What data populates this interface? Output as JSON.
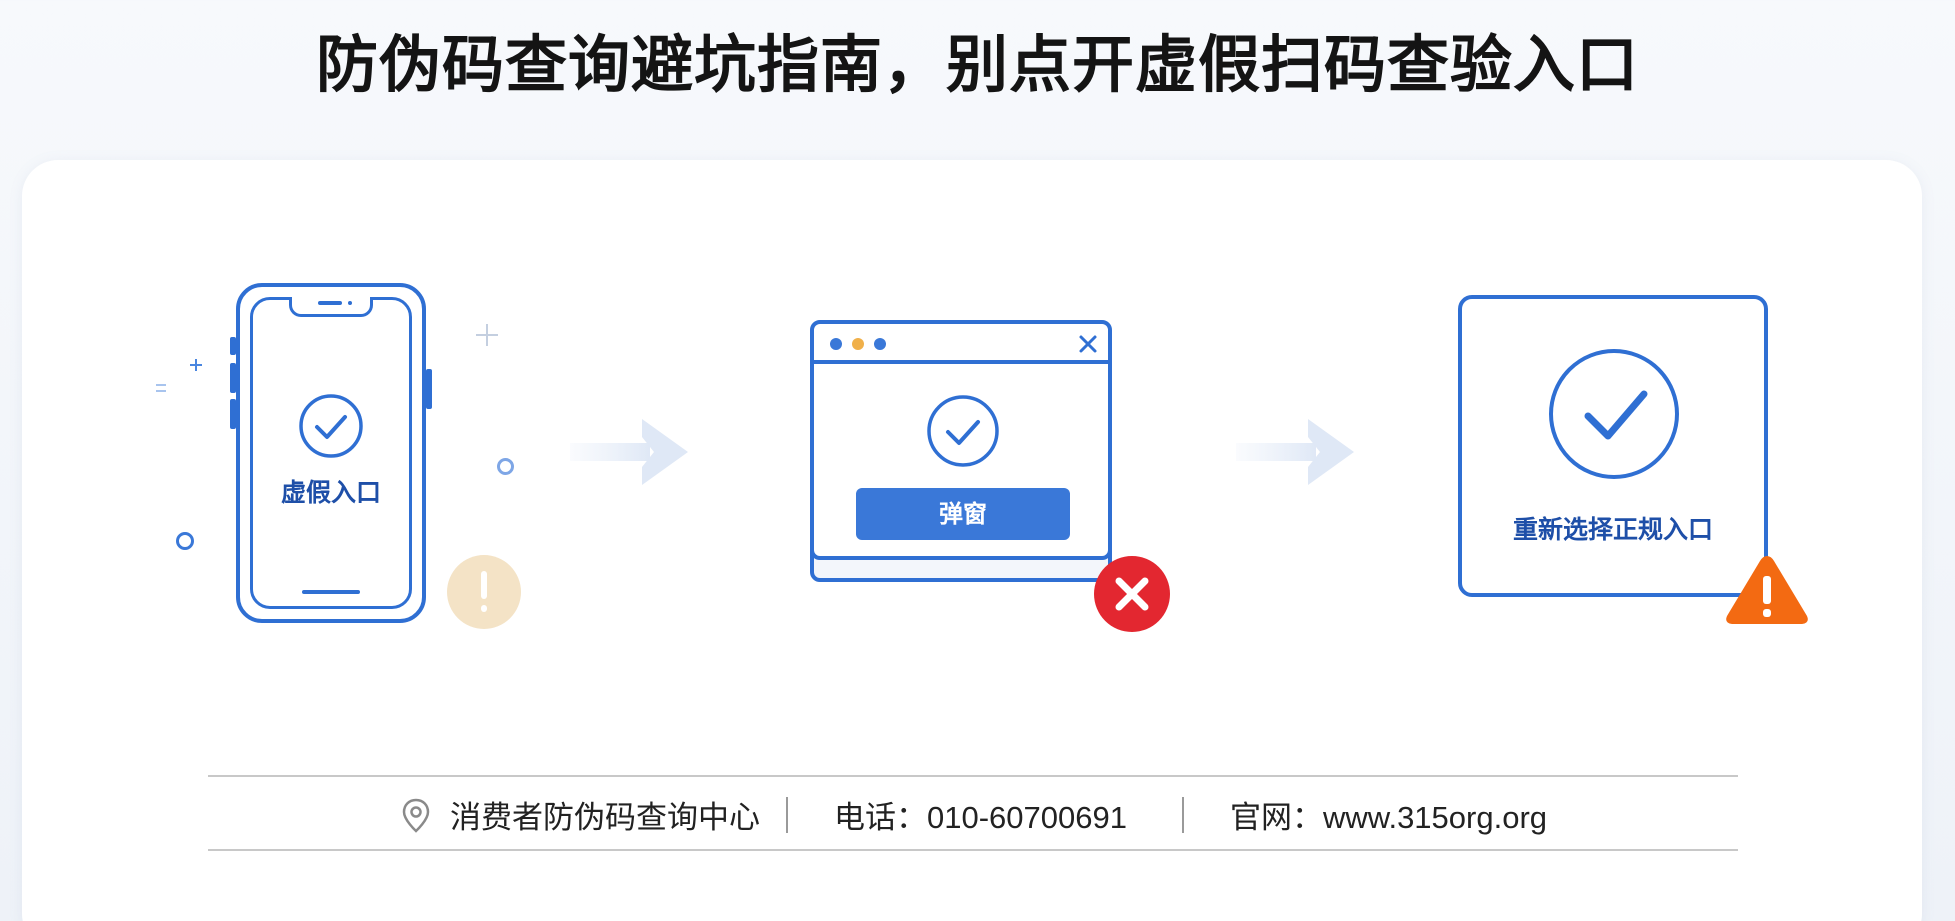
{
  "headline": "防伪码查询避坑指南，别点开虚假扫码查验入口",
  "steps": [
    {
      "label": "虚假入口",
      "icon": "check-circle-icon",
      "badge": "exclamation-icon"
    },
    {
      "button_label": "弹窗",
      "icon": "check-circle-icon",
      "badge": "error-x-icon",
      "close_icon": "close-icon"
    },
    {
      "label": "重新选择正规入口",
      "icon": "check-circle-icon",
      "badge": "warning-triangle-icon"
    }
  ],
  "footer": {
    "org": "消费者防伪码查询中心",
    "phone": "电话：010-60700691",
    "website": "官网：www.315org.org",
    "org_icon": "location-pin-icon"
  },
  "colors": {
    "accent_blue": "#2f6fd3",
    "button_blue": "#3a78d8",
    "error_red": "#e32730",
    "warning_orange": "#f36a12",
    "faded_badge": "#f3e2c4"
  }
}
